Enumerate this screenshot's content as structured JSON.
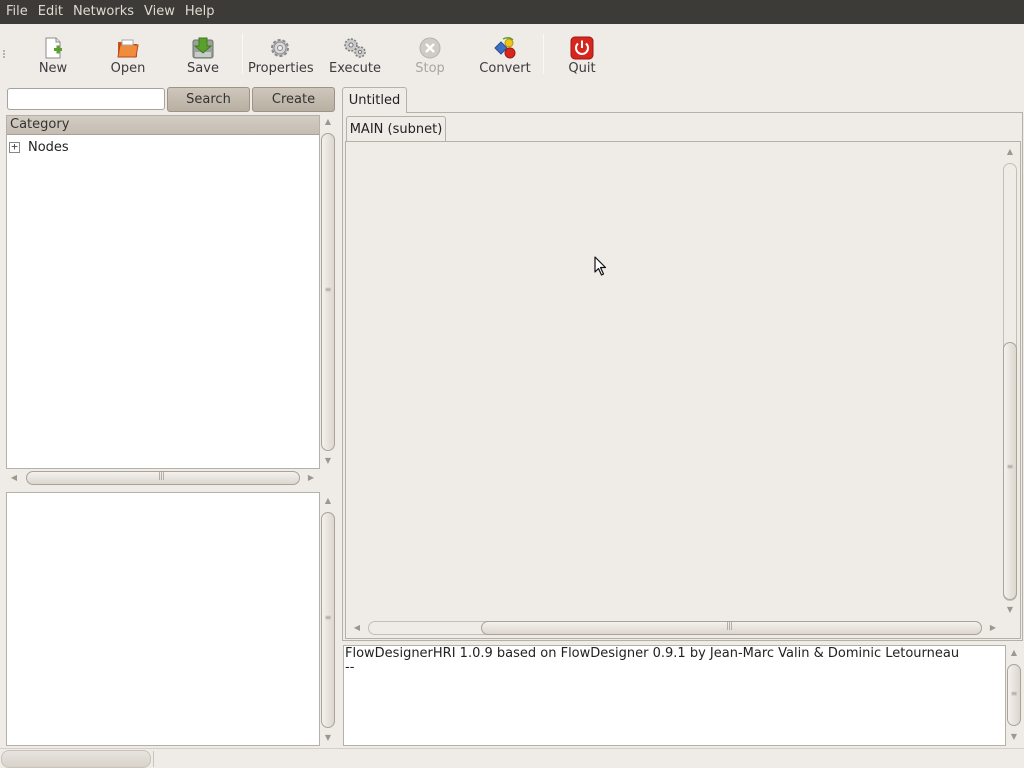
{
  "menubar": {
    "items": [
      "File",
      "Edit",
      "Networks",
      "View",
      "Help"
    ]
  },
  "toolbar": {
    "buttons": [
      {
        "label": "New",
        "icon": "new-document-icon"
      },
      {
        "label": "Open",
        "icon": "open-folder-icon"
      },
      {
        "label": "Save",
        "icon": "save-icon"
      },
      {
        "label": "Properties",
        "icon": "gear-icon"
      },
      {
        "label": "Execute",
        "icon": "execute-gears-icon"
      },
      {
        "label": "Stop",
        "icon": "stop-icon",
        "disabled": true
      },
      {
        "label": "Convert",
        "icon": "convert-icon"
      },
      {
        "label": "Quit",
        "icon": "power-icon"
      }
    ]
  },
  "search": {
    "value": "",
    "search_label": "Search",
    "create_label": "Create"
  },
  "category_tree": {
    "header": "Category",
    "items": [
      {
        "label": "Nodes",
        "expander": "+"
      }
    ]
  },
  "tabs": {
    "document_tab": "Untitled",
    "subnet_tab": "MAIN (subnet)"
  },
  "log": {
    "lines": [
      "FlowDesignerHRI 1.0.9 based on FlowDesigner 0.9.1 by Jean-Marc Valin & Dominic Letourneau",
      "--"
    ]
  },
  "colors": {
    "menubar_bg": "#3c3b37",
    "window_bg": "#efebe7",
    "quit_red": "#d7261e"
  }
}
